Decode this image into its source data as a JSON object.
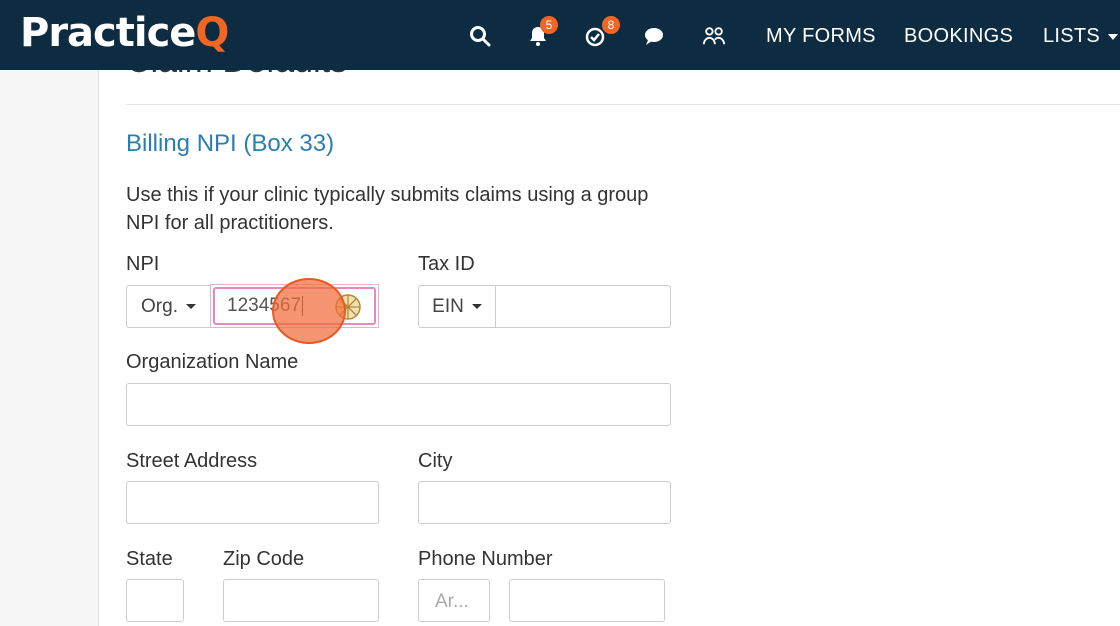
{
  "navbar": {
    "logo_main": "Practice",
    "logo_accent": "Q",
    "icons": [
      {
        "name": "search-icon"
      },
      {
        "name": "bell-icon",
        "badge": "5"
      },
      {
        "name": "check-circle-icon",
        "badge": "8"
      },
      {
        "name": "chat-icon"
      },
      {
        "name": "users-icon"
      }
    ],
    "links": [
      "MY FORMS",
      "BOOKINGS",
      "LISTS"
    ],
    "accent_color": "#f26522",
    "background_color": "#0d2c42"
  },
  "page": {
    "previous_heading": "Claim Defaults"
  },
  "billing": {
    "title": "Billing NPI (Box 33)",
    "description": "Use this if your clinic typically submits claims using a group NPI for all practitioners.",
    "npi_label": "NPI",
    "npi_type": "Org.",
    "npi_value": "1234567",
    "tax_id_label": "Tax ID",
    "tax_id_type": "EIN",
    "tax_id_value": "",
    "org_name_label": "Organization Name",
    "street_label": "Street Address",
    "city_label": "City",
    "state_label": "State",
    "zip_label": "Zip Code",
    "phone_label": "Phone Number",
    "phone_area_placeholder": "Ar..."
  }
}
